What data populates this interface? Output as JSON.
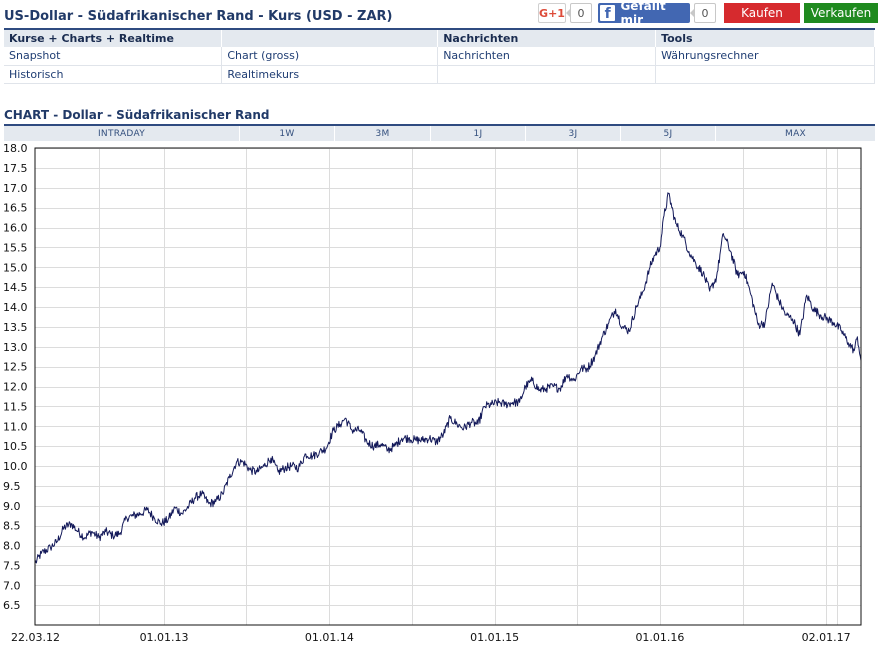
{
  "header": {
    "title": "US-Dollar - Südafrikanischer Rand - Kurs (USD - ZAR)"
  },
  "social": {
    "gplus_label": "G+1",
    "gplus_count": "0",
    "fb_icon": "f",
    "fb_label": "Gefällt mir",
    "fb_count": "0"
  },
  "trade": {
    "buy_label": "Kaufen",
    "sell_label": "Verkaufen",
    "buy_color": "#d62a2e",
    "sell_color": "#1f8a1f"
  },
  "nav": {
    "headers": [
      "Kurse + Charts + Realtime",
      "",
      "Nachrichten",
      "Tools"
    ],
    "rows": [
      [
        "Snapshot",
        "Chart (gross)",
        "Nachrichten",
        "Währungsrechner"
      ],
      [
        "Historisch",
        "Realtimekurs",
        "",
        ""
      ]
    ]
  },
  "chart_section": {
    "title": "CHART - Dollar - Südafrikanischer Rand",
    "tabs": [
      "INTRADAY",
      "1W",
      "3M",
      "1J",
      "3J",
      "5J",
      "MAX"
    ]
  },
  "chart_data": {
    "type": "line",
    "title": "",
    "xlabel": "",
    "ylabel": "",
    "ylim": [
      6.0,
      18.0
    ],
    "yticks": [
      6.5,
      7.0,
      7.5,
      8.0,
      8.5,
      9.0,
      9.5,
      10.0,
      10.5,
      11.0,
      11.5,
      12.0,
      12.5,
      13.0,
      13.5,
      14.0,
      14.5,
      15.0,
      15.5,
      16.0,
      16.5,
      17.0,
      17.5,
      18.0
    ],
    "xlim": [
      "2012-03-22",
      "2017-03-20"
    ],
    "xticks": [
      {
        "date": "2012-03-22",
        "label": "22.03.12"
      },
      {
        "date": "2013-01-01",
        "label": "01.01.13"
      },
      {
        "date": "2014-01-01",
        "label": "01.01.14"
      },
      {
        "date": "2015-01-01",
        "label": "01.01.15"
      },
      {
        "date": "2016-01-01",
        "label": "01.01.16"
      },
      {
        "date": "2017-01-02",
        "label": "02.01.17"
      }
    ],
    "grid": true,
    "line_color": "#141a5a",
    "series": [
      {
        "points": [
          [
            "2012-03-22",
            7.55
          ],
          [
            "2012-04-05",
            7.8
          ],
          [
            "2012-04-25",
            7.95
          ],
          [
            "2012-05-10",
            8.1
          ],
          [
            "2012-05-25",
            8.45
          ],
          [
            "2012-06-10",
            8.55
          ],
          [
            "2012-06-25",
            8.35
          ],
          [
            "2012-07-10",
            8.2
          ],
          [
            "2012-07-25",
            8.35
          ],
          [
            "2012-08-10",
            8.2
          ],
          [
            "2012-08-25",
            8.35
          ],
          [
            "2012-09-10",
            8.25
          ],
          [
            "2012-09-25",
            8.3
          ],
          [
            "2012-10-10",
            8.7
          ],
          [
            "2012-10-25",
            8.75
          ],
          [
            "2012-11-10",
            8.8
          ],
          [
            "2012-11-25",
            8.9
          ],
          [
            "2012-12-10",
            8.7
          ],
          [
            "2012-12-25",
            8.55
          ],
          [
            "2013-01-10",
            8.65
          ],
          [
            "2013-01-25",
            8.95
          ],
          [
            "2013-02-10",
            8.8
          ],
          [
            "2013-02-25",
            9.0
          ],
          [
            "2013-03-10",
            9.2
          ],
          [
            "2013-03-25",
            9.3
          ],
          [
            "2013-04-10",
            9.05
          ],
          [
            "2013-04-25",
            9.1
          ],
          [
            "2013-05-10",
            9.3
          ],
          [
            "2013-05-25",
            9.7
          ],
          [
            "2013-06-10",
            10.1
          ],
          [
            "2013-06-25",
            10.1
          ],
          [
            "2013-07-10",
            9.9
          ],
          [
            "2013-07-25",
            9.85
          ],
          [
            "2013-08-10",
            10.0
          ],
          [
            "2013-08-25",
            10.2
          ],
          [
            "2013-09-10",
            9.85
          ],
          [
            "2013-09-25",
            9.95
          ],
          [
            "2013-10-10",
            10.0
          ],
          [
            "2013-10-25",
            9.95
          ],
          [
            "2013-11-10",
            10.3
          ],
          [
            "2013-11-25",
            10.25
          ],
          [
            "2013-12-10",
            10.35
          ],
          [
            "2013-12-25",
            10.45
          ],
          [
            "2014-01-10",
            10.9
          ],
          [
            "2014-01-25",
            11.05
          ],
          [
            "2014-02-05",
            11.2
          ],
          [
            "2014-02-20",
            10.9
          ],
          [
            "2014-03-10",
            10.9
          ],
          [
            "2014-03-25",
            10.6
          ],
          [
            "2014-04-10",
            10.5
          ],
          [
            "2014-04-25",
            10.55
          ],
          [
            "2014-05-10",
            10.4
          ],
          [
            "2014-05-25",
            10.5
          ],
          [
            "2014-06-10",
            10.7
          ],
          [
            "2014-06-25",
            10.7
          ],
          [
            "2014-07-10",
            10.65
          ],
          [
            "2014-07-25",
            10.65
          ],
          [
            "2014-08-10",
            10.7
          ],
          [
            "2014-08-25",
            10.6
          ],
          [
            "2014-09-10",
            10.8
          ],
          [
            "2014-09-25",
            11.2
          ],
          [
            "2014-10-10",
            11.05
          ],
          [
            "2014-10-25",
            10.95
          ],
          [
            "2014-11-10",
            11.1
          ],
          [
            "2014-11-25",
            11.05
          ],
          [
            "2014-12-10",
            11.5
          ],
          [
            "2014-12-25",
            11.55
          ],
          [
            "2015-01-10",
            11.6
          ],
          [
            "2015-01-25",
            11.55
          ],
          [
            "2015-02-10",
            11.6
          ],
          [
            "2015-02-25",
            11.6
          ],
          [
            "2015-03-10",
            12.0
          ],
          [
            "2015-03-25",
            12.15
          ],
          [
            "2015-04-10",
            11.9
          ],
          [
            "2015-04-25",
            11.95
          ],
          [
            "2015-05-10",
            12.0
          ],
          [
            "2015-05-25",
            11.95
          ],
          [
            "2015-06-10",
            12.3
          ],
          [
            "2015-06-25",
            12.15
          ],
          [
            "2015-07-10",
            12.45
          ],
          [
            "2015-07-25",
            12.45
          ],
          [
            "2015-08-10",
            12.75
          ],
          [
            "2015-08-25",
            13.2
          ],
          [
            "2015-09-10",
            13.6
          ],
          [
            "2015-09-25",
            13.95
          ],
          [
            "2015-10-10",
            13.5
          ],
          [
            "2015-10-25",
            13.4
          ],
          [
            "2015-11-10",
            14.0
          ],
          [
            "2015-11-25",
            14.4
          ],
          [
            "2015-12-10",
            15.0
          ],
          [
            "2015-12-20",
            15.3
          ],
          [
            "2016-01-01",
            15.5
          ],
          [
            "2016-01-10",
            16.3
          ],
          [
            "2016-01-20",
            16.85
          ],
          [
            "2016-02-05",
            16.1
          ],
          [
            "2016-02-20",
            15.8
          ],
          [
            "2016-03-05",
            15.4
          ],
          [
            "2016-03-20",
            15.1
          ],
          [
            "2016-04-05",
            14.85
          ],
          [
            "2016-04-20",
            14.4
          ],
          [
            "2016-05-05",
            14.75
          ],
          [
            "2016-05-20",
            15.85
          ],
          [
            "2016-06-05",
            15.4
          ],
          [
            "2016-06-20",
            14.8
          ],
          [
            "2016-07-05",
            14.9
          ],
          [
            "2016-07-20",
            14.3
          ],
          [
            "2016-08-05",
            13.55
          ],
          [
            "2016-08-20",
            13.6
          ],
          [
            "2016-09-05",
            14.6
          ],
          [
            "2016-09-20",
            14.15
          ],
          [
            "2016-10-05",
            13.8
          ],
          [
            "2016-10-20",
            13.7
          ],
          [
            "2016-11-05",
            13.3
          ],
          [
            "2016-11-20",
            14.3
          ],
          [
            "2016-12-05",
            13.95
          ],
          [
            "2016-12-20",
            13.8
          ],
          [
            "2017-01-05",
            13.7
          ],
          [
            "2017-01-20",
            13.6
          ],
          [
            "2017-02-05",
            13.4
          ],
          [
            "2017-02-20",
            13.1
          ],
          [
            "2017-03-05",
            12.9
          ],
          [
            "2017-03-12",
            13.25
          ],
          [
            "2017-03-20",
            12.65
          ]
        ]
      }
    ]
  }
}
